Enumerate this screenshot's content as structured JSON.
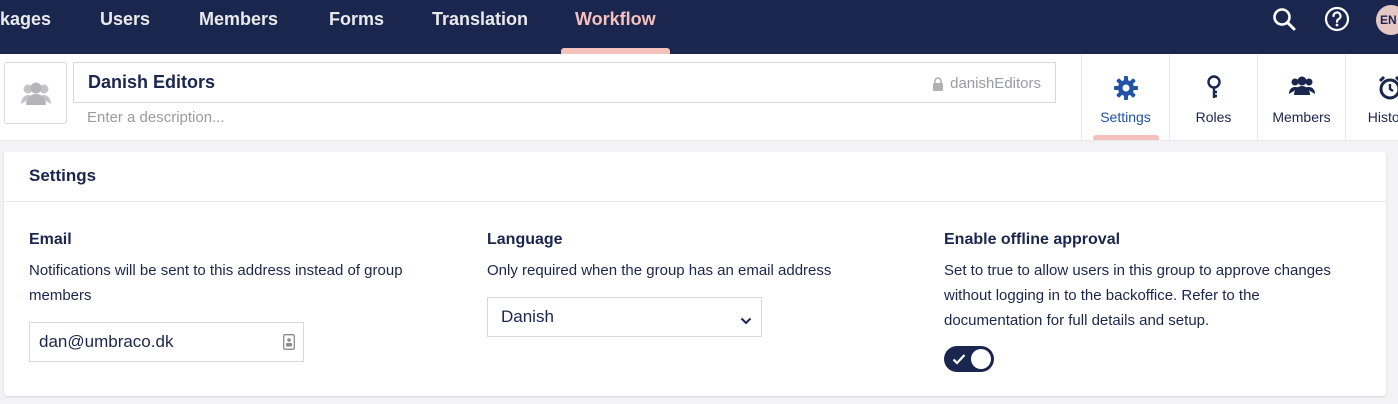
{
  "nav": {
    "items": [
      {
        "label": "kages"
      },
      {
        "label": "Users"
      },
      {
        "label": "Members"
      },
      {
        "label": "Forms"
      },
      {
        "label": "Translation"
      },
      {
        "label": "Workflow"
      }
    ],
    "active": "Workflow",
    "user_initials": "EN"
  },
  "header": {
    "group_name": "Danish Editors",
    "alias": "danishEditors",
    "description_placeholder": "Enter a description...",
    "apps": [
      {
        "label": "Settings",
        "icon": "gear-icon"
      },
      {
        "label": "Roles",
        "icon": "key-icon"
      },
      {
        "label": "Members",
        "icon": "users-icon"
      },
      {
        "label": "History",
        "icon": "clock-icon"
      }
    ]
  },
  "settings": {
    "title": "Settings",
    "email": {
      "label": "Email",
      "description": "Notifications will be sent to this address instead of group members",
      "value": "dan@umbraco.dk"
    },
    "language": {
      "label": "Language",
      "description": "Only required when the group has an email address",
      "selected": "Danish"
    },
    "offline_approval": {
      "label": "Enable offline approval",
      "description": "Set to true to allow users in this group to approve changes without logging in to the backoffice. Refer to the documentation for full details and setup.",
      "enabled": true
    }
  },
  "colors": {
    "nav_bg": "#1b264f",
    "accent": "#f5c1bc",
    "active_app": "#2152a3"
  }
}
